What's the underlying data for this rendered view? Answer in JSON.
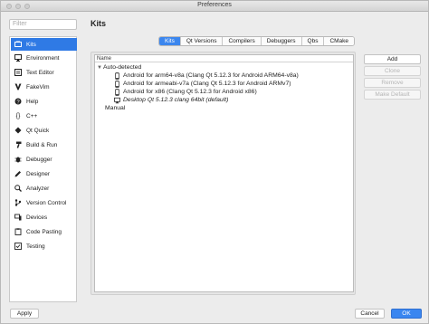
{
  "window": {
    "title": "Preferences"
  },
  "filter": {
    "placeholder": "Filter"
  },
  "sidebar": {
    "items": [
      {
        "label": "Kits",
        "icon": "kits-icon",
        "selected": true
      },
      {
        "label": "Environment",
        "icon": "monitor-icon"
      },
      {
        "label": "Text Editor",
        "icon": "text-editor-icon"
      },
      {
        "label": "FakeVim",
        "icon": "fakevim-icon"
      },
      {
        "label": "Help",
        "icon": "help-icon"
      },
      {
        "label": "C++",
        "icon": "braces-icon"
      },
      {
        "label": "Qt Quick",
        "icon": "qt-quick-icon"
      },
      {
        "label": "Build & Run",
        "icon": "hammer-icon"
      },
      {
        "label": "Debugger",
        "icon": "bug-icon"
      },
      {
        "label": "Designer",
        "icon": "pencil-icon"
      },
      {
        "label": "Analyzer",
        "icon": "analyzer-icon"
      },
      {
        "label": "Version Control",
        "icon": "version-control-icon"
      },
      {
        "label": "Devices",
        "icon": "devices-icon"
      },
      {
        "label": "Code Pasting",
        "icon": "clipboard-icon"
      },
      {
        "label": "Testing",
        "icon": "testing-icon"
      }
    ]
  },
  "main": {
    "title": "Kits",
    "tabs": [
      "Kits",
      "Qt Versions",
      "Compilers",
      "Debuggers",
      "Qbs",
      "CMake"
    ],
    "active_tab": "Kits",
    "tree": {
      "column": "Name",
      "auto_detected": "Auto-detected",
      "kits": [
        "Android for arm64-v8a (Clang Qt 5.12.3 for Android ARM64-v8a)",
        "Android for armeabi-v7a (Clang Qt 5.12.3 for Android ARMv7)",
        "Android for x86 (Clang Qt 5.12.3 for Android x86)",
        "Desktop Qt 5.12.3 clang 64bit (default)"
      ],
      "manual": "Manual"
    },
    "buttons": {
      "add": "Add",
      "clone": "Clone",
      "remove": "Remove",
      "make_default": "Make Default"
    }
  },
  "footer": {
    "apply": "Apply",
    "cancel": "Cancel",
    "ok": "OK"
  },
  "colors": {
    "accent": "#2f7ae5",
    "tab_active": "#3b86ee"
  }
}
